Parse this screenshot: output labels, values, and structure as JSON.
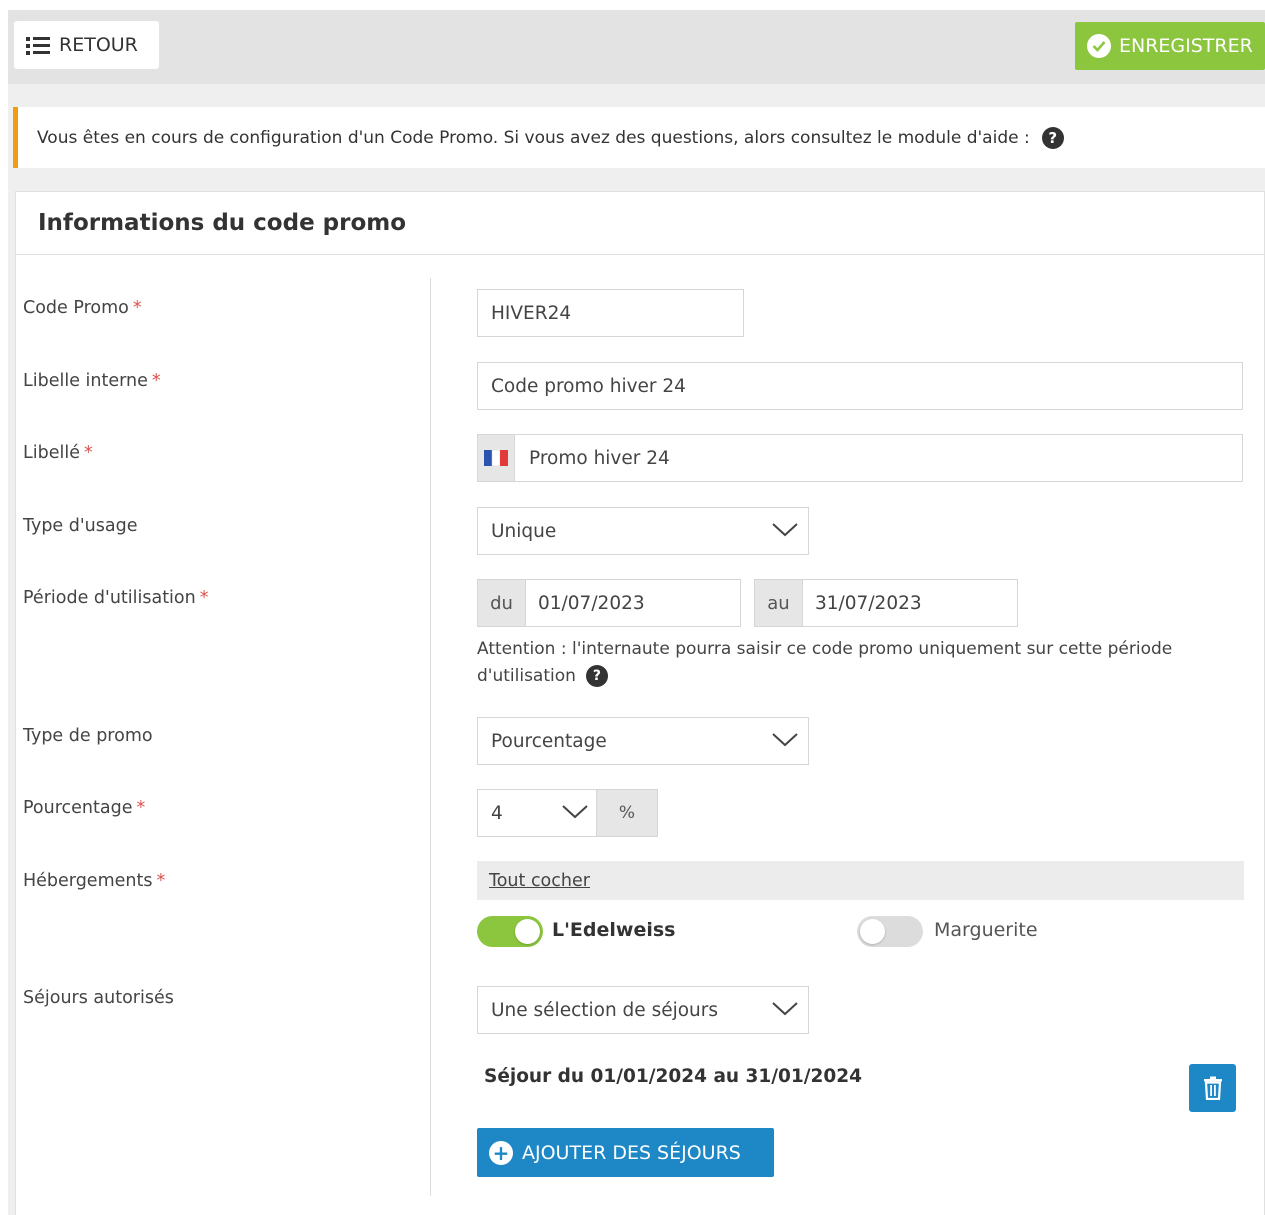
{
  "toolbar": {
    "back_label": "RETOUR",
    "save_label": "ENREGISTRER",
    "save_color": "#8cc63f"
  },
  "alert": {
    "text": "Vous êtes en cours de configuration d'un Code Promo. Si vous avez des questions, alors consultez le module d'aide :",
    "accent_color": "#f39c12"
  },
  "panel": {
    "title": "Informations du code promo"
  },
  "form": {
    "code_promo": {
      "label": "Code Promo",
      "required": "*",
      "value": "HIVER24"
    },
    "libelle_interne": {
      "label": "Libelle interne",
      "required": "*",
      "value": "Code promo hiver 24"
    },
    "libelle": {
      "label": "Libellé",
      "required": "*",
      "value": "Promo hiver 24",
      "language_icon": "french-flag-icon"
    },
    "type_usage": {
      "label": "Type d'usage",
      "value": "Unique"
    },
    "periode": {
      "label": "Période d'utilisation",
      "required": "*",
      "from_prefix": "du",
      "from_value": "01/07/2023",
      "to_prefix": "au",
      "to_value": "31/07/2023",
      "hint": "Attention : l'internaute pourra saisir ce code promo uniquement sur cette période d'utilisation"
    },
    "type_promo": {
      "label": "Type de promo",
      "value": "Pourcentage"
    },
    "pourcentage": {
      "label": "Pourcentage",
      "required": "*",
      "value": "4",
      "unit": "%"
    },
    "hebergements": {
      "label": "Hébergements",
      "required": "*",
      "select_all": "Tout cocher",
      "items": [
        {
          "name": "L'Edelweiss",
          "checked": true
        },
        {
          "name": "Marguerite",
          "checked": false
        }
      ],
      "toggle_on_color": "#8cc63f",
      "toggle_off_color": "#dcdcdc"
    },
    "sejours": {
      "label": "Séjours autorisés",
      "value": "Une sélection de séjours",
      "entries": [
        "Séjour du 01/01/2024 au 31/01/2024"
      ],
      "add_label": "AJOUTER DES SÉJOURS",
      "button_color": "#1e88c7"
    }
  }
}
